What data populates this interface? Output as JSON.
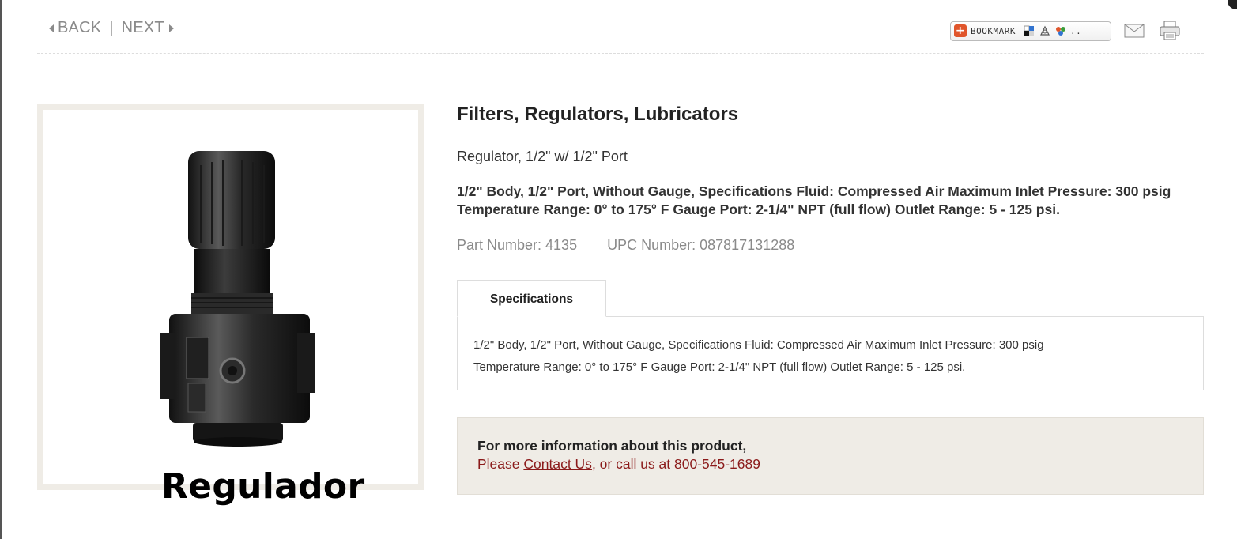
{
  "nav": {
    "back_label": "BACK",
    "separator": "|",
    "next_label": "NEXT"
  },
  "tools": {
    "bookmark_label": "BOOKMARK",
    "bookmark_more": "..",
    "icons": [
      "bookmark-plus-icon",
      "delicious-icon",
      "digg-icon",
      "stumbleupon-icon",
      "mail-icon",
      "print-icon"
    ]
  },
  "product": {
    "image_caption": "Regulador",
    "category": "Filters, Regulators, Lubricators",
    "name": "Regulator, 1/2\" w/ 1/2\" Port",
    "description": "1/2\" Body, 1/2\" Port, Without Gauge, Specifications Fluid: Compressed Air Maximum Inlet Pressure: 300 psig Temperature Range: 0° to 175° F Gauge Port: 2-1/4\" NPT (full flow) Outlet Range: 5 - 125 psi.",
    "part_number": "Part Number: 4135",
    "upc_number": "UPC Number: 087817131288"
  },
  "tabs": [
    {
      "label": "Specifications"
    }
  ],
  "specifications": {
    "line1": "1/2\" Body, 1/2\" Port, Without Gauge, Specifications Fluid: Compressed Air Maximum Inlet Pressure: 300 psig",
    "line2": "Temperature Range: 0° to 175° F Gauge Port: 2-1/4\" NPT (full flow) Outlet Range: 5 - 125 psi."
  },
  "contact": {
    "line1": "For more information about this product,",
    "please": "Please ",
    "link": "Contact Us",
    "rest": ", or call us at 800-545-1689"
  },
  "colors": {
    "accent_red": "#8b1a1a",
    "panel_beige": "#efece6",
    "nav_gray": "#8a8a8a"
  }
}
